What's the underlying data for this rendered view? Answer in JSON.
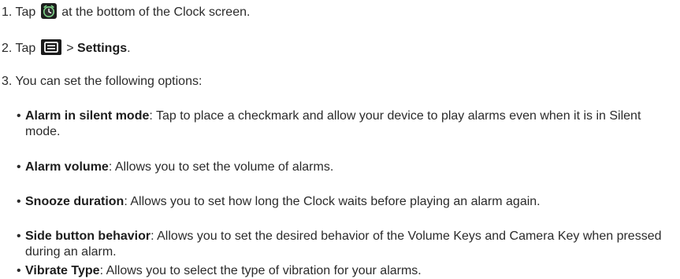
{
  "steps": [
    {
      "prefix": "1. Tap",
      "icon": "alarm-clock-icon",
      "suffix": "at the bottom of the Clock screen."
    },
    {
      "prefix": "2. Tap",
      "icon": "menu-key-icon",
      "separator": ">",
      "bold": "Settings",
      "suffix": "."
    },
    {
      "text": "3. You can set the following options:"
    }
  ],
  "options": [
    {
      "term": "Alarm in silent mode",
      "desc": ": Tap to place a checkmark and allow your device to play alarms even when it is in Silent mode."
    },
    {
      "term": "Alarm volume",
      "desc": ": Allows you to set the volume of alarms."
    },
    {
      "term": "Snooze duration",
      "desc": ": Allows you to set how long the Clock waits before playing an alarm again."
    },
    {
      "term": "Side button behavior",
      "desc": ": Allows you to set the desired behavior of the Volume Keys and Camera Key when pressed during an alarm."
    },
    {
      "term": "Vibrate Type",
      "desc": ": Allows you to select the type of vibration for your alarms."
    }
  ],
  "colors": {
    "text": "#2b2b2b",
    "icon_bg": "#222222",
    "icon_accent": "#2fa84f"
  }
}
